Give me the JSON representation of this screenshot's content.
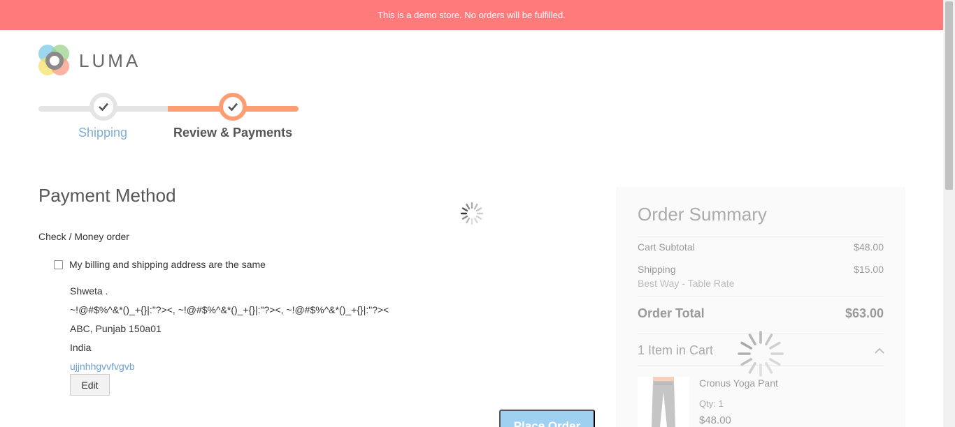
{
  "notice": "This is a demo store. No orders will be fulfilled.",
  "logo": {
    "text": "LUMA"
  },
  "progress": {
    "steps": [
      {
        "label": "Shipping",
        "state": "complete"
      },
      {
        "label": "Review & Payments",
        "state": "active"
      }
    ]
  },
  "payment": {
    "title": "Payment Method",
    "method": "Check / Money order",
    "billing_same_label": "My billing and shipping address are the same",
    "billing_same_checked": false,
    "address": {
      "name": "Shweta .",
      "street": "~!@#$%^&*()_+{}|:\"?><, ~!@#$%^&*()_+{}|:\"?><, ~!@#$%^&*()_+{}|:\"?><",
      "city_line": "ABC, Punjab 150a01",
      "country": "India",
      "phone": "ujjnhhgvvfvgvb"
    },
    "edit_label": "Edit",
    "place_order_label": "Place Order"
  },
  "summary": {
    "title": "Order Summary",
    "cart_subtotal_label": "Cart Subtotal",
    "cart_subtotal_value": "$48.00",
    "shipping_label": "Shipping",
    "shipping_value": "$15.00",
    "shipping_method": "Best Way - Table Rate",
    "total_label": "Order Total",
    "total_value": "$63.00",
    "items_label": "1 Item in Cart",
    "item": {
      "name": "Cronus Yoga Pant",
      "qty": "Qty: 1",
      "price": "$48.00"
    }
  },
  "colors": {
    "notice_bg": "#ff7b7b",
    "progress_active": "#ff9d72",
    "link": "#7eafd8",
    "primary_button_disabled": "#9ed0ef"
  }
}
